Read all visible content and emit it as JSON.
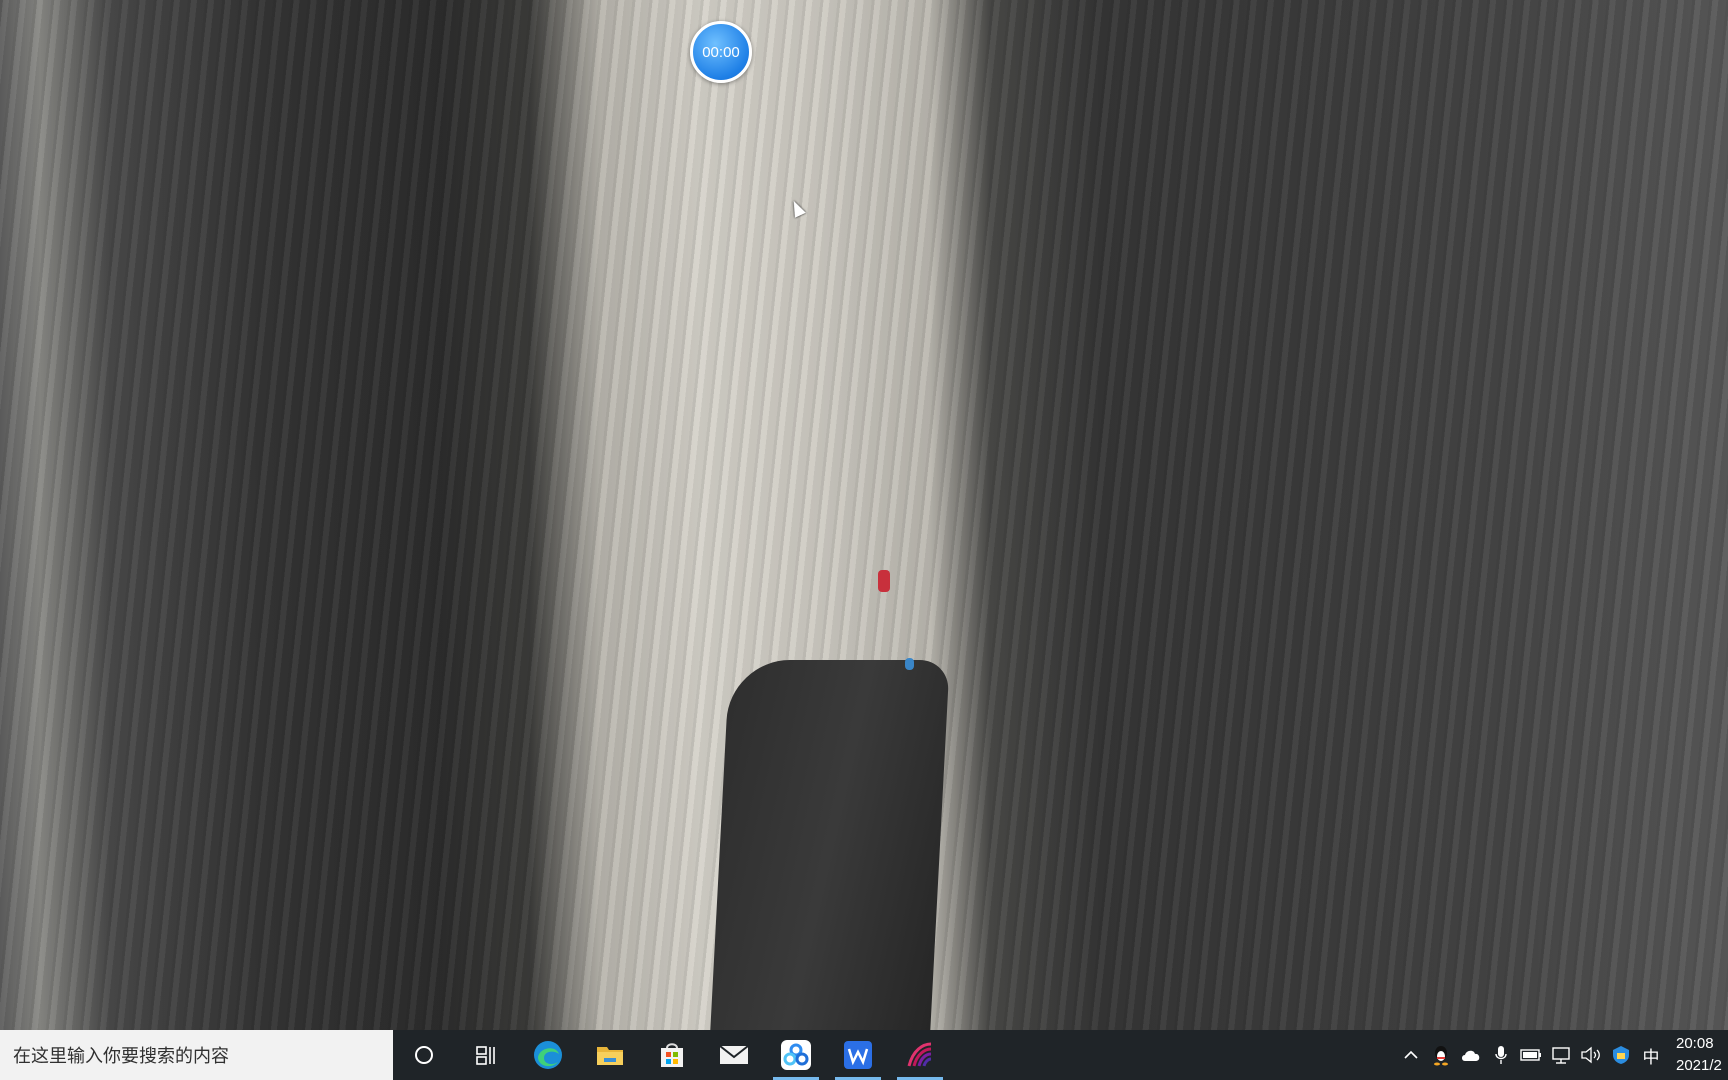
{
  "timer": {
    "label": "00:00"
  },
  "search": {
    "placeholder": "在这里输入你要搜索的内容"
  },
  "taskbar": {
    "buttons": [
      {
        "name": "cortana-icon"
      },
      {
        "name": "task-view-icon"
      },
      {
        "name": "edge-icon"
      },
      {
        "name": "file-explorer-icon"
      },
      {
        "name": "microsoft-store-icon"
      },
      {
        "name": "mail-icon"
      },
      {
        "name": "baidu-netdisk-icon",
        "active": true
      },
      {
        "name": "wps-writer-icon",
        "active": true
      },
      {
        "name": "app-icon",
        "active": true
      }
    ],
    "accent": "#76b9ed",
    "background": "#1f2428"
  },
  "tray": {
    "ime_label": "中",
    "time": "20:08",
    "date": "2021/2"
  }
}
